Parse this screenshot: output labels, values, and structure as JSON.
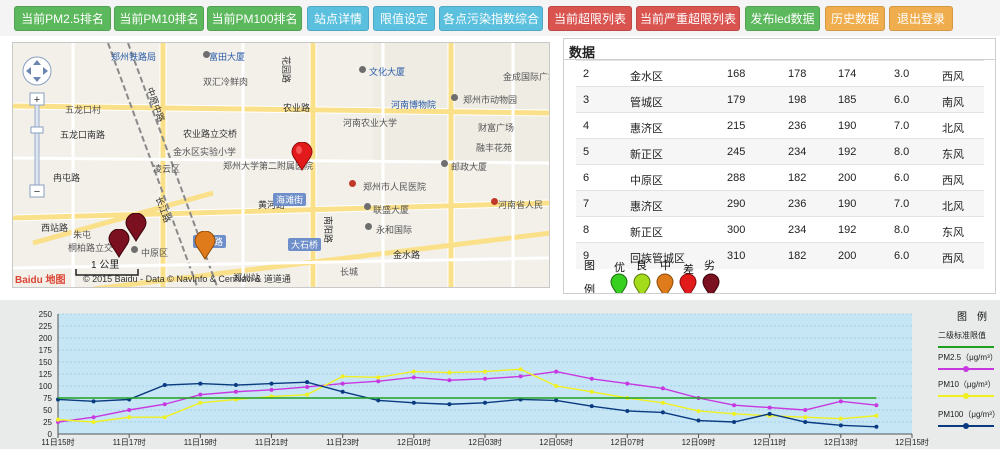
{
  "toolbar": {
    "buttons": [
      {
        "label": "当前PM2.5排名",
        "color": "green"
      },
      {
        "label": "当前PM10排名",
        "color": "green"
      },
      {
        "label": "当前PM100排名",
        "color": "green"
      },
      {
        "label": "站点详情",
        "color": "teal"
      },
      {
        "label": "限值设定",
        "color": "teal"
      },
      {
        "label": "各点污染指数综合",
        "color": "teal"
      },
      {
        "label": "当前超限列表",
        "color": "red"
      },
      {
        "label": "当前严重超限列表",
        "color": "red"
      },
      {
        "label": "发布led数据",
        "color": "green"
      },
      {
        "label": "历史数据",
        "color": "orange"
      },
      {
        "label": "退出登录",
        "color": "orange"
      }
    ]
  },
  "map": {
    "labels": [
      {
        "t": "郑州铁路局",
        "c": "blue"
      },
      {
        "t": "富田大厦",
        "c": "blue"
      },
      {
        "t": "文化大厦",
        "c": "blue"
      },
      {
        "t": "双汇冷鲜肉",
        "c": ""
      },
      {
        "t": "金成国际广场",
        "c": ""
      },
      {
        "t": "河南博物院",
        "c": "blue"
      },
      {
        "t": "郑州市动物园",
        "c": ""
      },
      {
        "t": "农业路",
        "c": "road"
      },
      {
        "t": "河南农业大学",
        "c": ""
      },
      {
        "t": "财富广场",
        "c": ""
      },
      {
        "t": "五龙口村",
        "c": ""
      },
      {
        "t": "农业路立交桥",
        "c": "road"
      },
      {
        "t": "融丰花苑",
        "c": ""
      },
      {
        "t": "五龙口南路",
        "c": "road"
      },
      {
        "t": "金水区实验小学",
        "c": ""
      },
      {
        "t": "郑州大学第二附属医院",
        "c": ""
      },
      {
        "t": "邮政大厦",
        "c": ""
      },
      {
        "t": "冉屯路",
        "c": "road"
      },
      {
        "t": "凌云区",
        "c": ""
      },
      {
        "t": "郑州市人民医院",
        "c": ""
      },
      {
        "t": "黄河路",
        "c": "road"
      },
      {
        "t": "海滩街",
        "c": "pill"
      },
      {
        "t": "联盛大厦",
        "c": ""
      },
      {
        "t": "西站路",
        "c": "road"
      },
      {
        "t": "永和国际",
        "c": ""
      },
      {
        "t": "河南省人民",
        "c": ""
      },
      {
        "t": "朱屯",
        "c": ""
      },
      {
        "t": "桐柏路立交",
        "c": ""
      },
      {
        "t": "中原区",
        "c": ""
      },
      {
        "t": "建设路",
        "c": "pill"
      },
      {
        "t": "大石桥",
        "c": "pill"
      },
      {
        "t": "金水路",
        "c": "road"
      },
      {
        "t": "长城",
        "c": ""
      },
      {
        "t": "中原中路",
        "c": "road"
      },
      {
        "t": "长江路",
        "c": "road"
      },
      {
        "t": "南阳路",
        "c": "road"
      },
      {
        "t": "郑州站",
        "c": "road"
      },
      {
        "t": "花园路",
        "c": "road"
      }
    ],
    "scale_label": "1 公里",
    "copyright": "© 2015 Baidu - Data © NavInfo & CenNavi & 道道通",
    "logo": "Baidu 地图",
    "markers": [
      {
        "level": "poor",
        "color": "#e31a1c"
      },
      {
        "level": "severe",
        "color": "#7a1020"
      },
      {
        "level": "severe",
        "color": "#7a1020"
      },
      {
        "level": "moderate",
        "color": "#e07b1c"
      }
    ]
  },
  "data_panel": {
    "title": "数据",
    "rows": [
      {
        "id": "2",
        "district": "金水区",
        "pm25": "168",
        "pm10": "178",
        "pm100": "174",
        "wind_speed": "3.0",
        "wind_dir": "西风"
      },
      {
        "id": "3",
        "district": "管城区",
        "pm25": "179",
        "pm10": "198",
        "pm100": "185",
        "wind_speed": "6.0",
        "wind_dir": "南风"
      },
      {
        "id": "4",
        "district": "惠济区",
        "pm25": "215",
        "pm10": "236",
        "pm100": "190",
        "wind_speed": "7.0",
        "wind_dir": "北风"
      },
      {
        "id": "5",
        "district": "新正区",
        "pm25": "245",
        "pm10": "234",
        "pm100": "192",
        "wind_speed": "8.0",
        "wind_dir": "东风"
      },
      {
        "id": "6",
        "district": "中原区",
        "pm25": "288",
        "pm10": "182",
        "pm100": "200",
        "wind_speed": "6.0",
        "wind_dir": "西风"
      },
      {
        "id": "7",
        "district": "惠济区",
        "pm25": "290",
        "pm10": "236",
        "pm100": "190",
        "wind_speed": "7.0",
        "wind_dir": "北风"
      },
      {
        "id": "8",
        "district": "新正区",
        "pm25": "300",
        "pm10": "234",
        "pm100": "192",
        "wind_speed": "8.0",
        "wind_dir": "东风"
      },
      {
        "id": "9",
        "district": "回族管城区",
        "pm25": "310",
        "pm10": "182",
        "pm100": "200",
        "wind_speed": "6.0",
        "wind_dir": "西风"
      }
    ],
    "legend_title_a": "图",
    "legend_title_b": "例",
    "legend": [
      {
        "label": "优",
        "color": "#38d020"
      },
      {
        "label": "良",
        "color": "#a4dc1c"
      },
      {
        "label": "中",
        "color": "#e07b1c"
      },
      {
        "label": "差",
        "color": "#e31a1c"
      },
      {
        "label": "劣",
        "color": "#7a1020"
      }
    ]
  },
  "chart_data": {
    "type": "line",
    "x": [
      "11日15时",
      "11日16时",
      "11日17时",
      "11日18时",
      "11日19时",
      "11日20时",
      "11日21时",
      "11日22时",
      "11日23时",
      "12日00时",
      "12日01时",
      "12日02时",
      "12日03时",
      "12日04时",
      "12日05时",
      "12日06时",
      "12日07时",
      "12日08时",
      "12日09时",
      "12日10时",
      "12日11时",
      "12日12时",
      "12日13时",
      "12日14时"
    ],
    "tick_labels": [
      "11日15时",
      "11日17时",
      "11日19时",
      "11日21时",
      "11日23时",
      "12日01时",
      "12日03时",
      "12日05时",
      "12日07时",
      "12日09时",
      "12日11时",
      "12日13时",
      "12日15时"
    ],
    "ylim": [
      0,
      250
    ],
    "yticks": [
      0,
      25,
      50,
      75,
      100,
      125,
      150,
      175,
      200,
      225,
      250
    ],
    "series": [
      {
        "name": "PM2.5（μg/m³）",
        "color": "#c838e0",
        "values": [
          25,
          35,
          50,
          62,
          82,
          88,
          92,
          98,
          105,
          110,
          118,
          112,
          115,
          120,
          130,
          115,
          105,
          95,
          75,
          60,
          55,
          50,
          68,
          60
        ]
      },
      {
        "name": "PM10（μg/m³）",
        "color": "#f0f020",
        "values": [
          30,
          25,
          35,
          35,
          65,
          72,
          78,
          82,
          120,
          118,
          130,
          128,
          130,
          135,
          100,
          88,
          75,
          65,
          48,
          42,
          38,
          35,
          32,
          38
        ]
      },
      {
        "name": "PM100（μg/m³）",
        "color": "#0a3a80",
        "values": [
          72,
          68,
          72,
          102,
          105,
          102,
          105,
          108,
          88,
          70,
          65,
          62,
          65,
          72,
          70,
          58,
          48,
          45,
          28,
          25,
          42,
          25,
          18,
          15
        ]
      },
      {
        "name": "二级标准限值",
        "color": "#20a020",
        "values": [
          75,
          75,
          75,
          75,
          75,
          75,
          75,
          75,
          75,
          75,
          75,
          75,
          75,
          75,
          75,
          75,
          75,
          75,
          75,
          75,
          75,
          75,
          75,
          75
        ]
      }
    ],
    "legend_title": "图　例",
    "legend_position": "right"
  }
}
